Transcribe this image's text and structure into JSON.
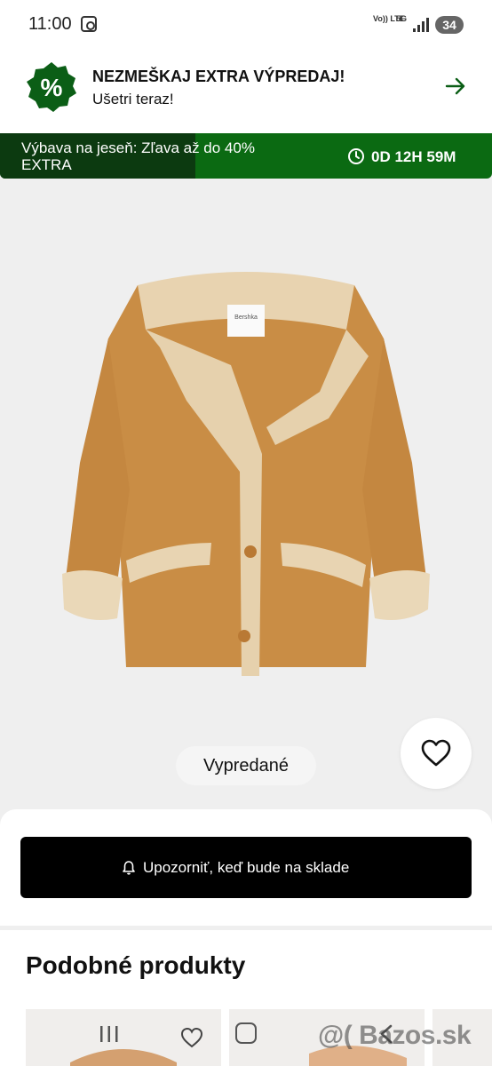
{
  "status_bar": {
    "time": "11:00",
    "net_volte": "Vo)) LTE",
    "net_5g": "5G",
    "battery": "34"
  },
  "promo": {
    "title": "NEZMEŠKAJ EXTRA VÝPREDAJ!",
    "subtitle": "Ušetri teraz!",
    "badge_symbol": "%",
    "badge_icon": "percent-badge-icon",
    "arrow_icon": "arrow-right-icon",
    "accent_color": "#0b5e16"
  },
  "countdown": {
    "text": "Výbava na jeseň: Zľava až do 40% EXTRA",
    "timer": "0D 12H 59M",
    "icon": "clock-icon",
    "colors": {
      "dark": "#0c3a10",
      "green": "#0b6a12"
    }
  },
  "product": {
    "availability": "Vypredané",
    "wishlist_icon": "heart-icon",
    "tag_text": "Bershka"
  },
  "notify": {
    "label": "Upozorniť, keď bude na sklade",
    "icon": "bell-icon"
  },
  "similar": {
    "title": "Podobné produkty"
  },
  "nav": {
    "watermark": "@( Bazos.sk",
    "recent_icon": "recent-apps-icon",
    "home_icon": "home-icon",
    "back_icon": "back-icon"
  }
}
